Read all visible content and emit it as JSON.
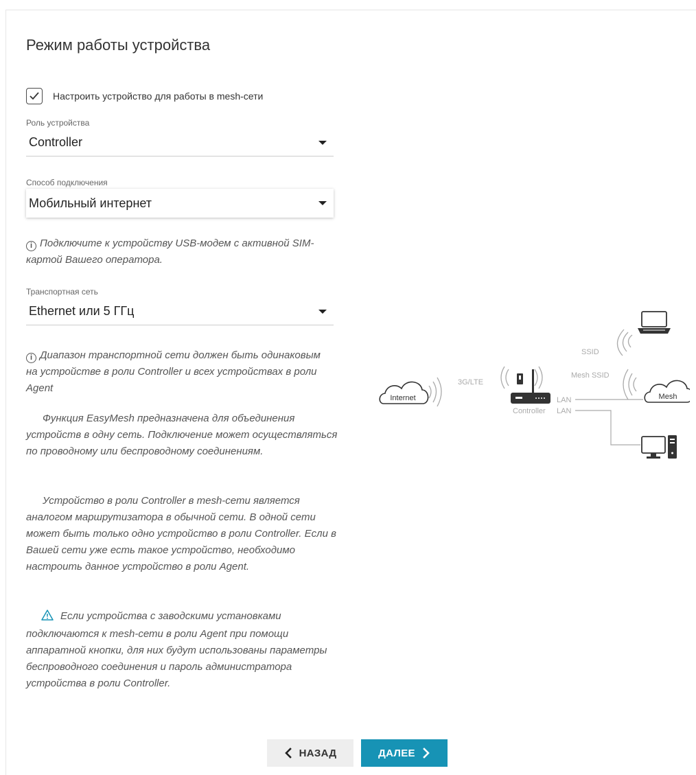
{
  "page": {
    "title": "Режим работы устройства"
  },
  "mesh_checkbox": {
    "label": "Настроить устройство для работы в mesh-сети",
    "checked": true
  },
  "role_field": {
    "label": "Роль устройства",
    "value": "Controller"
  },
  "connection_field": {
    "label": "Способ подключения",
    "value": "Мобильный интернет"
  },
  "connection_note": "Подключите к устройству USB-модем с активной SIM-картой Вашего оператора.",
  "transport_field": {
    "label": "Транспортная сеть",
    "value": "Ethernet или 5 ГГц"
  },
  "transport_note": "Диапазон транспортной сети должен быть одинаковым на устройстве в роли Controller и всех устройствах в роли Agent",
  "para_easymesh": "Функция EasyMesh предназначена для объединения устройств в одну сеть. Подключение может осуществляться по проводному или беспроводному соединениям.",
  "para_controller": "Устройство в роли Controller в mesh-сети является аналогом маршрутизатора в обычной сети. В одной сети может быть только одно устройство в роли Controller. Если в Вашей сети уже есть такое устройство, необходимо настроить данное устройство в роли Agent.",
  "para_warning": "Если устройства с заводскими установками подключаются к mesh-сети в роли Agent при помощи аппаратной кнопки, для них будут использованы параметры беспроводного соединения и пароль администратора устройства в роли Controller.",
  "diagram": {
    "internet": "Internet",
    "link_3g": "3G/LTE",
    "ssid": "SSID",
    "mesh_ssid": "Mesh SSID",
    "controller": "Controller",
    "lan1": "LAN",
    "lan2": "LAN",
    "mesh": "Mesh"
  },
  "buttons": {
    "back": "НАЗАД",
    "next": "ДАЛЕЕ"
  },
  "colors": {
    "accent": "#1793b5",
    "warning_icon": "#1793b5",
    "diagram_dark": "#333333",
    "diagram_light": "#bbbbbb"
  }
}
